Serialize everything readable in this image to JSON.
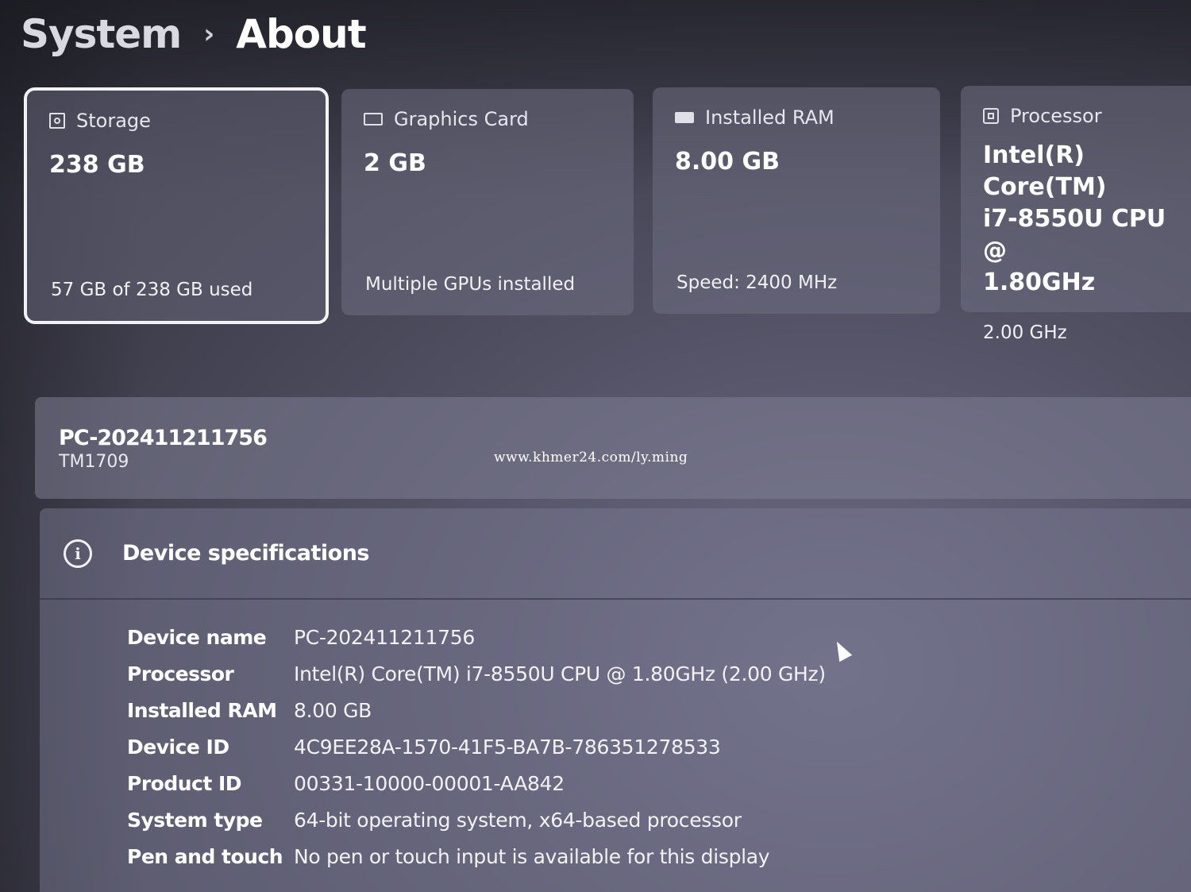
{
  "breadcrumb": {
    "root": "System",
    "separator": "›",
    "current": "About"
  },
  "cards": [
    {
      "name": "storage",
      "icon": "storage-icon",
      "title": "Storage",
      "value": "238 GB",
      "sub": "57 GB of 238 GB used"
    },
    {
      "name": "graphics-card",
      "icon": "graphics-card-icon",
      "title": "Graphics Card",
      "value": "2 GB",
      "sub": "Multiple GPUs installed"
    },
    {
      "name": "installed-ram",
      "icon": "ram-icon",
      "title": "Installed RAM",
      "value": "8.00 GB",
      "sub": "Speed: 2400 MHz"
    },
    {
      "name": "processor",
      "icon": "processor-icon",
      "title": "Processor",
      "value_lines": [
        "Intel(R) Core(TM)",
        "i7-8550U CPU @",
        "1.80GHz"
      ],
      "sub": "2.00 GHz"
    }
  ],
  "pc": {
    "name": "PC-202411211756",
    "model": "TM1709"
  },
  "watermark": "www.khmer24.com/ly.ming",
  "specs": {
    "title": "Device specifications",
    "rows": [
      {
        "label": "Device name",
        "value": "PC-202411211756"
      },
      {
        "label": "Processor",
        "value": "Intel(R) Core(TM) i7-8550U CPU @ 1.80GHz (2.00 GHz)"
      },
      {
        "label": "Installed RAM",
        "value": "8.00 GB"
      },
      {
        "label": "Device ID",
        "value": "4C9EE28A-1570-41F5-BA7B-786351278533"
      },
      {
        "label": "Product ID",
        "value": "00331-10000-00001-AA842"
      },
      {
        "label": "System type",
        "value": "64-bit operating system, x64-based processor"
      },
      {
        "label": "Pen and touch",
        "value": "No pen or touch input is available for this display"
      }
    ]
  }
}
